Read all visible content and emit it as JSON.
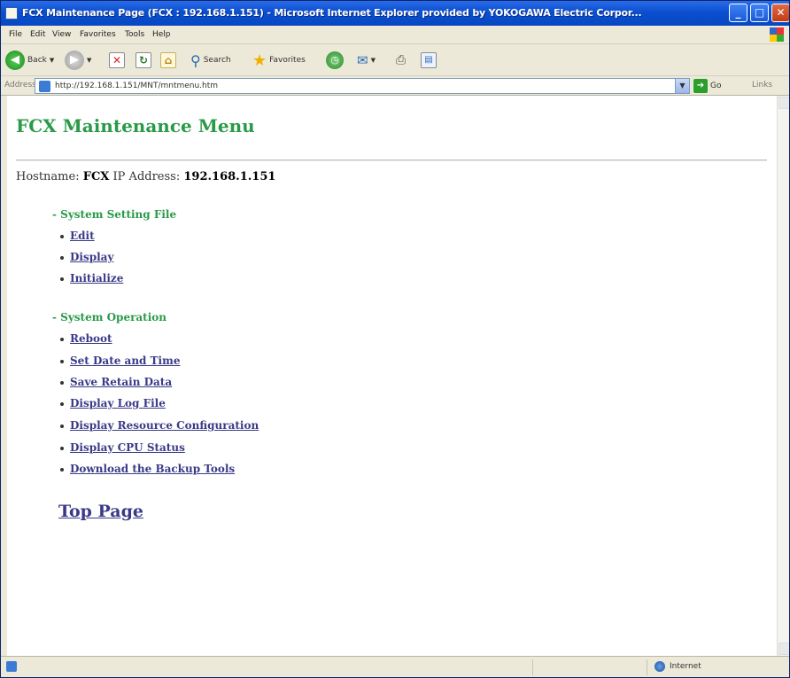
{
  "window": {
    "title": "FCX Maintenance Page (FCX : 192.168.1.151) - Microsoft Internet Explorer provided by YOKOGAWA Electric Corpor...",
    "minimize_icon": "minimize-icon",
    "maximize_icon": "maximize-icon",
    "close_icon": "close-icon"
  },
  "menu": {
    "items": [
      "File",
      "Edit",
      "View",
      "Favorites",
      "Tools",
      "Help"
    ]
  },
  "toolbar": {
    "back_label": "Back",
    "search_label": "Search",
    "favorites_label": "Favorites"
  },
  "address": {
    "label": "Address",
    "url": "http://192.168.1.151/MNT/mntmenu.htm",
    "go_label": "Go",
    "links_label": "Links"
  },
  "page": {
    "title": "FCX Maintenance Menu",
    "hostname_label": "Hostname:",
    "hostname": "FCX",
    "ip_label": "IP Address:",
    "ip": "192.168.1.151",
    "sections": [
      {
        "title": "- System Setting File",
        "links": [
          "Edit",
          "Display",
          "Initialize"
        ]
      },
      {
        "title": "- System Operation",
        "links": [
          "Reboot",
          "Set Date and Time",
          "Save Retain Data",
          "Display Log File",
          "Display Resource Configuration",
          "Display CPU Status",
          "Download the Backup Tools"
        ]
      }
    ],
    "top_page": "Top Page"
  },
  "status": {
    "zone": "Internet"
  },
  "colors": {
    "heading_green": "#2a9a48",
    "link": "#3a3a88",
    "titlebar_blue": "#0a4fd0"
  }
}
